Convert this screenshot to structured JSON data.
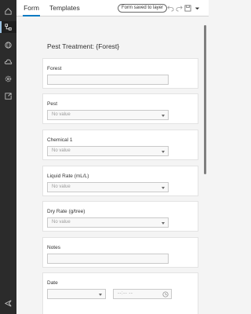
{
  "tabs": {
    "form": "Form",
    "templates": "Templates"
  },
  "status_badge": "Form saved to layer",
  "toolbar_icons": [
    "undo-icon",
    "redo-icon",
    "save-icon",
    "chevron-down-icon"
  ],
  "sidebar_icons": [
    "home-icon",
    "form-builder-icon",
    "globe-icon",
    "cloud-icon",
    "settings-icon",
    "share-icon",
    "collapse-icon"
  ],
  "form": {
    "title": "Pest Treatment: {Forest}",
    "fields": [
      {
        "label": "Forest",
        "kind": "text"
      },
      {
        "label": "Pest",
        "kind": "select",
        "value": "No value"
      },
      {
        "label": "Chemical 1",
        "kind": "select",
        "value": "No value"
      },
      {
        "label": "Liquid Rate (mL/L)",
        "kind": "select",
        "value": "No value"
      },
      {
        "label": "Dry Rate (g/tree)",
        "kind": "select",
        "value": "No value"
      },
      {
        "label": "Notes",
        "kind": "text"
      },
      {
        "label": "Date",
        "kind": "datetime",
        "time_value": "--:-- --"
      }
    ]
  }
}
